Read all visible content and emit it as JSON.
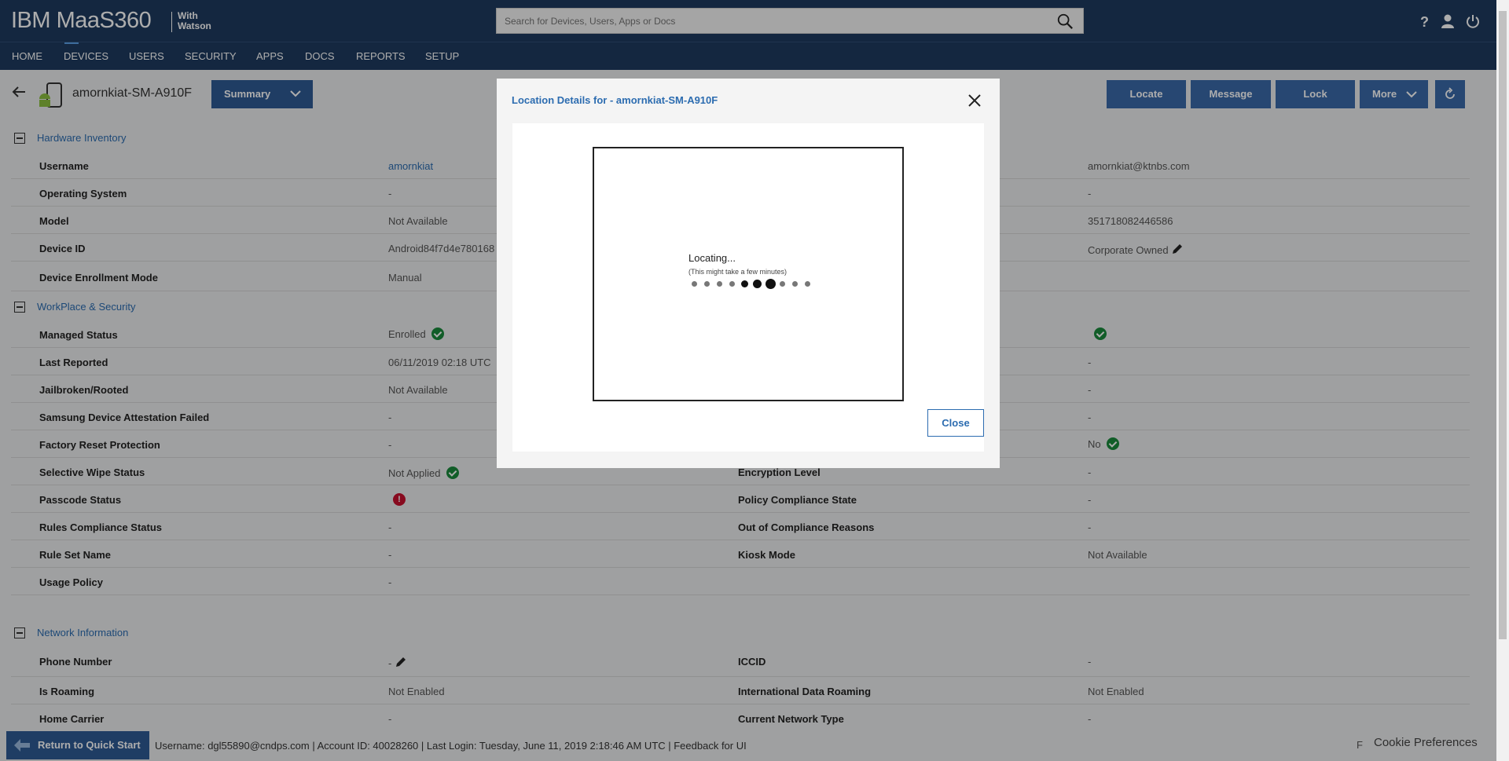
{
  "header": {
    "brand": "IBM MaaS360",
    "brand_with_1": "With",
    "brand_with_2": "Watson",
    "search_placeholder": "Search for Devices, Users, Apps or Docs",
    "icons": [
      "help-icon",
      "user-icon",
      "power-icon"
    ]
  },
  "nav": {
    "items": [
      "HOME",
      "DEVICES",
      "USERS",
      "SECURITY",
      "APPS",
      "DOCS",
      "REPORTS",
      "SETUP"
    ],
    "active": "DEVICES"
  },
  "device": {
    "name": "amornkiat-SM-A910F",
    "view_label": "Summary",
    "actions": [
      "Locate",
      "Message",
      "Lock",
      "More"
    ]
  },
  "sections": {
    "hardware": "Hardware Inventory",
    "workplace": "WorkPlace & Security",
    "network": "Network Information"
  },
  "hardware_rows": [
    {
      "label": "Username",
      "value": "amornkiat",
      "value2": "amornkiat@ktnbs.com"
    },
    {
      "label": "Operating System",
      "value": "-",
      "value2": "-"
    },
    {
      "label": "Model",
      "value": "Not Available",
      "value2": "351718082446586"
    },
    {
      "label": "Device ID",
      "value": "Android84f7d4e780168",
      "value2": "Corporate Owned"
    },
    {
      "label": "Device Enrollment Mode",
      "value": "Manual",
      "value2": ""
    }
  ],
  "workplace_rows": [
    {
      "label": "Managed Status",
      "value": "Enrolled",
      "label2": "",
      "value2": ""
    },
    {
      "label": "Last Reported",
      "value": "06/11/2019 02:18 UTC",
      "label2": "",
      "value2": "-"
    },
    {
      "label": "Jailbroken/Rooted",
      "value": "Not Available",
      "label2": "",
      "value2": "-"
    },
    {
      "label": "Samsung Device Attestation Failed",
      "value": "-",
      "label2": "",
      "value2": "-"
    },
    {
      "label": "Factory Reset Protection",
      "value": "-",
      "label2": "",
      "value2": "No"
    },
    {
      "label": "Selective Wipe Status",
      "value": "Not Applied",
      "label2": "Encryption Level",
      "value2": "-"
    },
    {
      "label": "Passcode Status",
      "value": "",
      "label2": "Policy Compliance State",
      "value2": "-"
    },
    {
      "label": "Rules Compliance Status",
      "value": "-",
      "label2": "Out of Compliance Reasons",
      "value2": "-"
    },
    {
      "label": "Rule Set Name",
      "value": "-",
      "label2": "Kiosk Mode",
      "value2": "Not Available"
    },
    {
      "label": "Usage Policy",
      "value": "-",
      "label2": "",
      "value2": ""
    }
  ],
  "network_rows": [
    {
      "label": "Phone Number",
      "value": "-",
      "label2": "ICCID",
      "value2": "-"
    },
    {
      "label": "Is Roaming",
      "value": "Not Enabled",
      "label2": "International Data Roaming",
      "value2": "Not Enabled"
    },
    {
      "label": "Home Carrier",
      "value": "-",
      "label2": "Current Network Type",
      "value2": "-"
    }
  ],
  "footer": {
    "quickstart": "Return to Quick Start",
    "info": "Username:  dgl55890@cndps.com  |  Account ID:  40028260  |  Last Login: Tuesday, June 11, 2019 2:18:46 AM UTC   |  Feedback for UI",
    "cookie": "Cookie Preferences",
    "cookie_prefix": "F"
  },
  "modal": {
    "title": "Location Details for - amornkiat-SM-A910F",
    "loading": "Locating...",
    "loading_sub": "(This might take a few minutes)",
    "close_label": "Close"
  },
  "colors": {
    "brand_bar": "#1e3a5f",
    "button": "#3a69a8",
    "link": "#2c6cb0",
    "success": "#1a8a3c",
    "error": "#c8102e"
  }
}
